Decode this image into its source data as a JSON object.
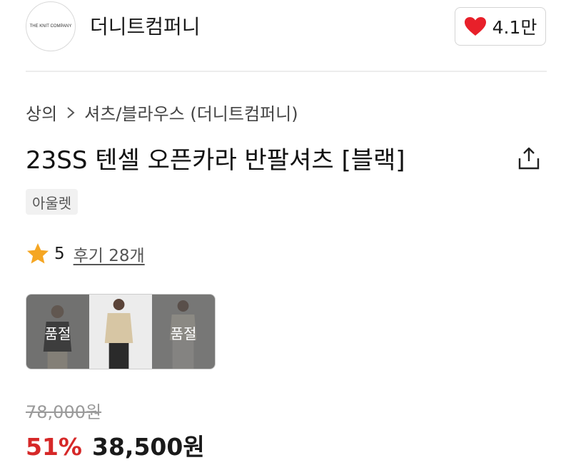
{
  "store": {
    "logo_text": "THE KNIT COMPANY",
    "name": "더니트컴퍼니",
    "like_count": "4.1만",
    "heart_color": "#e8202a"
  },
  "breadcrumb": {
    "level1": "상의",
    "level2": "셔츠/블라우스 (더니트컴퍼니)"
  },
  "product": {
    "title": "23SS 텐셀 오픈카라 반팔셔츠 [블랙]",
    "tag": "아울렛"
  },
  "rating": {
    "score": "5",
    "review_link": "후기 28개",
    "star_color": "#f5a623"
  },
  "thumbnails": [
    {
      "label": "품절",
      "sold_out": true
    },
    {
      "label": "",
      "sold_out": false
    },
    {
      "label": "품절",
      "sold_out": true
    }
  ],
  "price": {
    "original": "78,000원",
    "discount": "51%",
    "sale": "38,500원",
    "discount_color": "#d62828"
  }
}
